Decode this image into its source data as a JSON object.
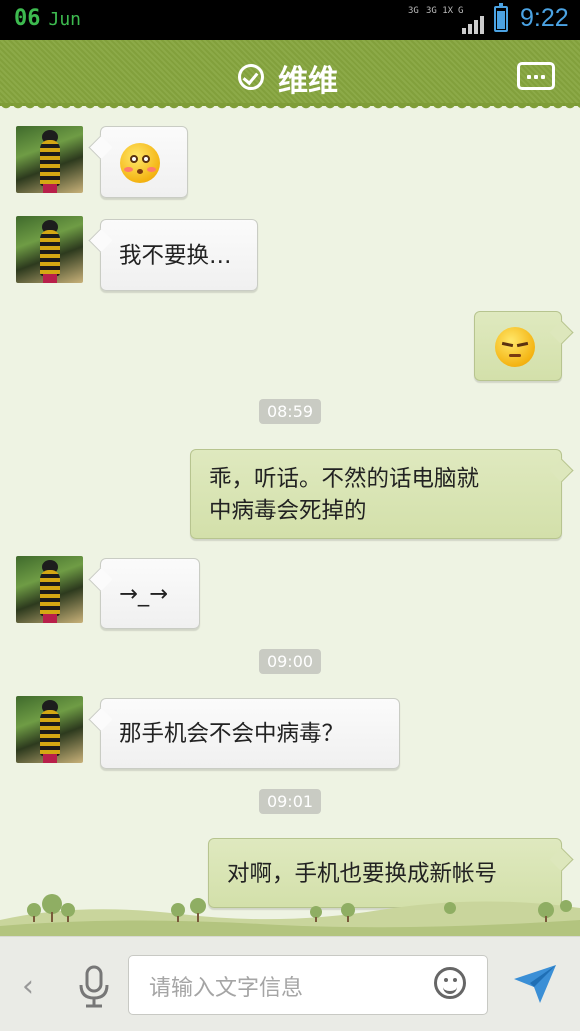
{
  "status_bar": {
    "day": "06",
    "month": "Jun",
    "network_labels": [
      "3G",
      "3G 1X",
      "G"
    ],
    "battery_level": 0.8,
    "time": "9:22"
  },
  "header": {
    "title": "维维",
    "verified_icon": "check-circle-icon",
    "more_icon": "more-icon",
    "color": "#86a53e"
  },
  "messages": [
    {
      "side": "left",
      "kind": "emoji",
      "emoji": "blushing-face"
    },
    {
      "side": "left",
      "kind": "text",
      "text": "我不要换…"
    },
    {
      "side": "right",
      "kind": "emoji",
      "emoji": "annoyed-face"
    },
    {
      "kind": "time",
      "text": "08:59"
    },
    {
      "side": "right",
      "kind": "text",
      "lines": [
        "乖，听话。不然的话电脑就",
        "中病毒会死掉的"
      ]
    },
    {
      "side": "left",
      "kind": "text",
      "text": "→_→"
    },
    {
      "kind": "time",
      "text": "09:00"
    },
    {
      "side": "left",
      "kind": "text",
      "text": "那手机会不会中病毒？"
    },
    {
      "kind": "time",
      "text": "09:01"
    },
    {
      "side": "right",
      "kind": "text",
      "text": "对啊，手机也要换成新帐号"
    }
  ],
  "input_bar": {
    "placeholder": "请输入文字信息",
    "icons": [
      "back-chevron-icon",
      "microphone-icon",
      "smiley-icon",
      "send-icon"
    ]
  },
  "colors": {
    "chat_background": "#eef3e3",
    "outgoing_bubble": "#d6e2ae",
    "incoming_bubble": "#f7f7f7",
    "status_green": "#3dba4f",
    "status_blue": "#4ba3e3"
  }
}
